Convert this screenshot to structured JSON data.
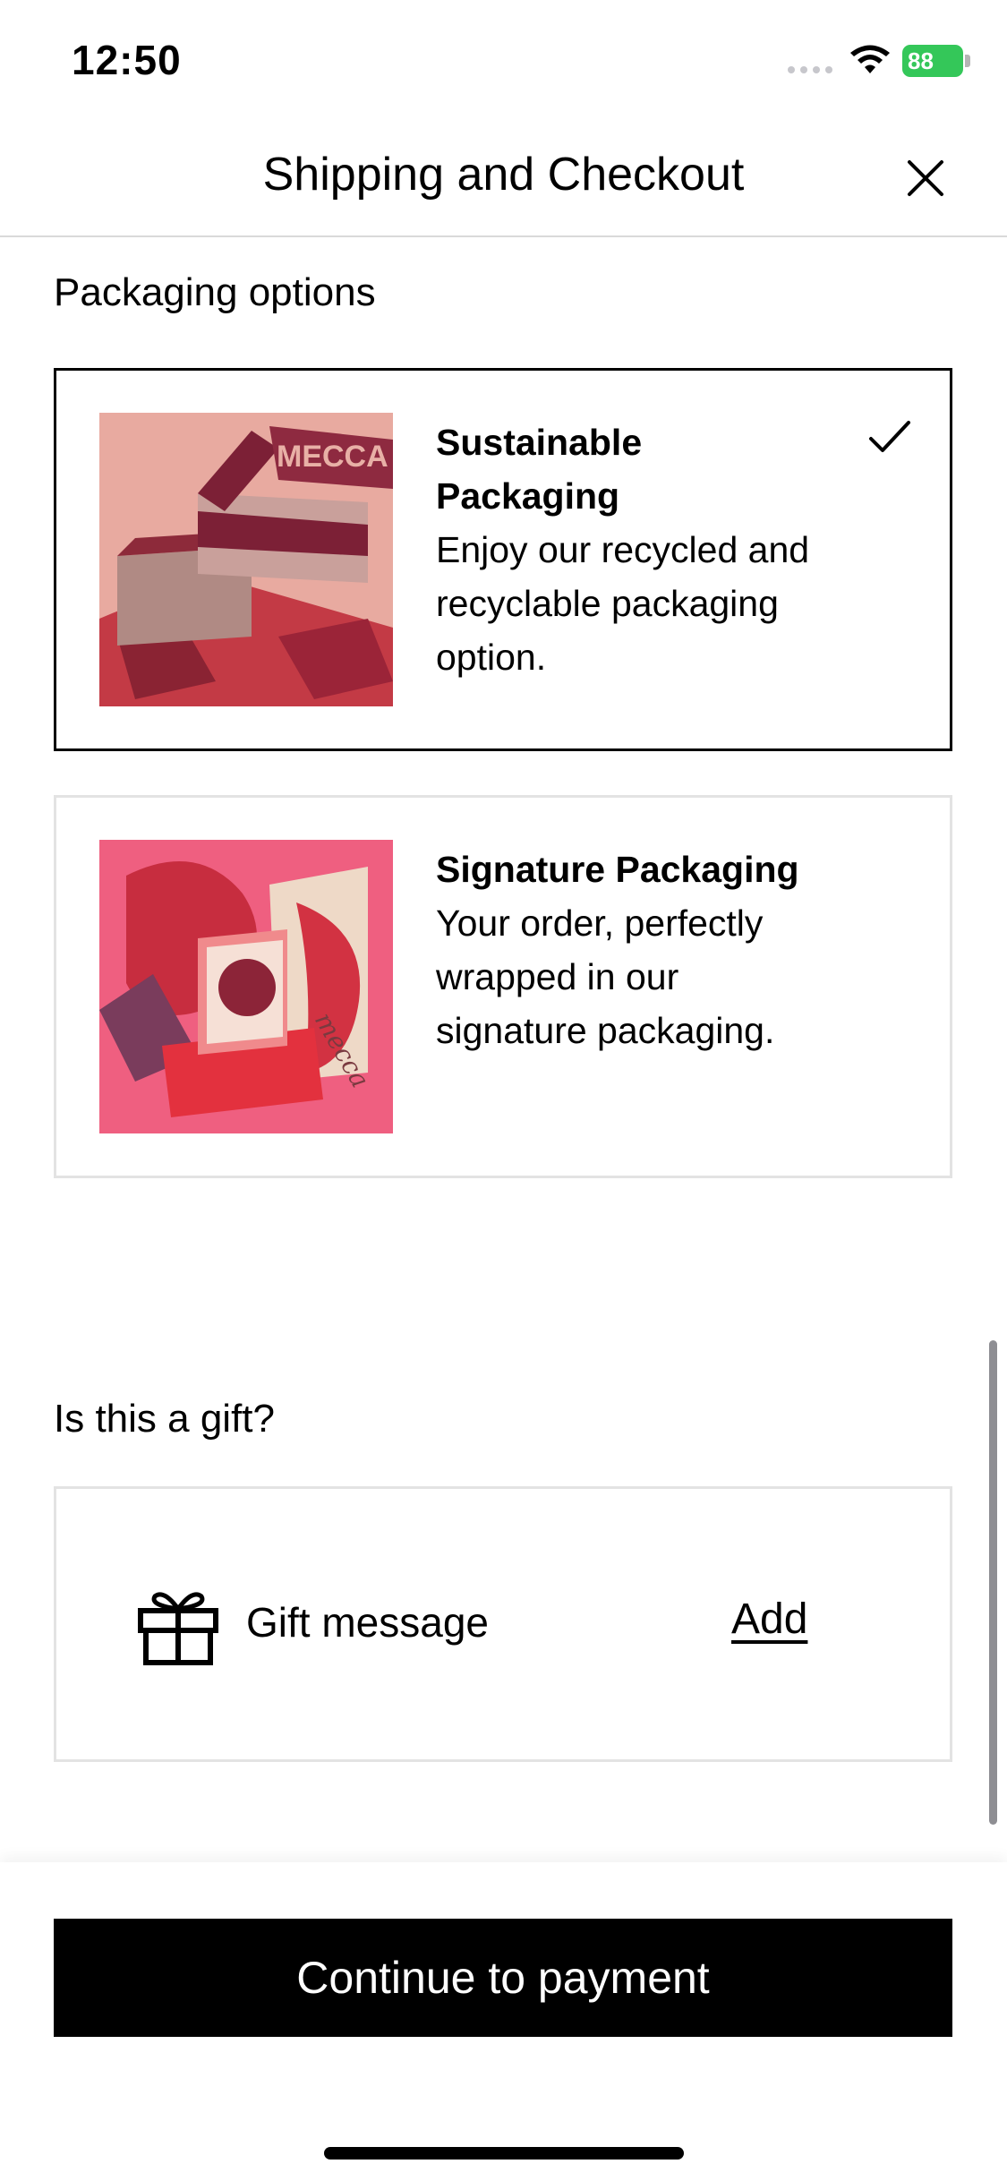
{
  "status_bar": {
    "time": "12:50",
    "battery": "88",
    "icons": [
      "cellular-signal-icon",
      "wifi-icon",
      "battery-charging-icon"
    ]
  },
  "header": {
    "title": "Shipping and Checkout",
    "close_icon": "close-icon"
  },
  "packaging": {
    "section_title": "Packaging options",
    "options": [
      {
        "name": "Sustainable Packaging",
        "description": "Enjoy our recycled and recyclable packaging option.",
        "image_text": "MECCA",
        "selected": true
      },
      {
        "name": "Signature Packaging",
        "description": "Your order, perfectly wrapped in our signature packaging.",
        "image_text": "mecca",
        "selected": false
      }
    ]
  },
  "gift": {
    "section_title": "Is this a gift?",
    "label": "Gift message",
    "action": "Add",
    "icon": "gift-icon"
  },
  "footer": {
    "continue_label": "Continue to payment"
  },
  "colors": {
    "primary": "#000000",
    "border_light": "#e3e3e3",
    "battery_green": "#34c759"
  }
}
